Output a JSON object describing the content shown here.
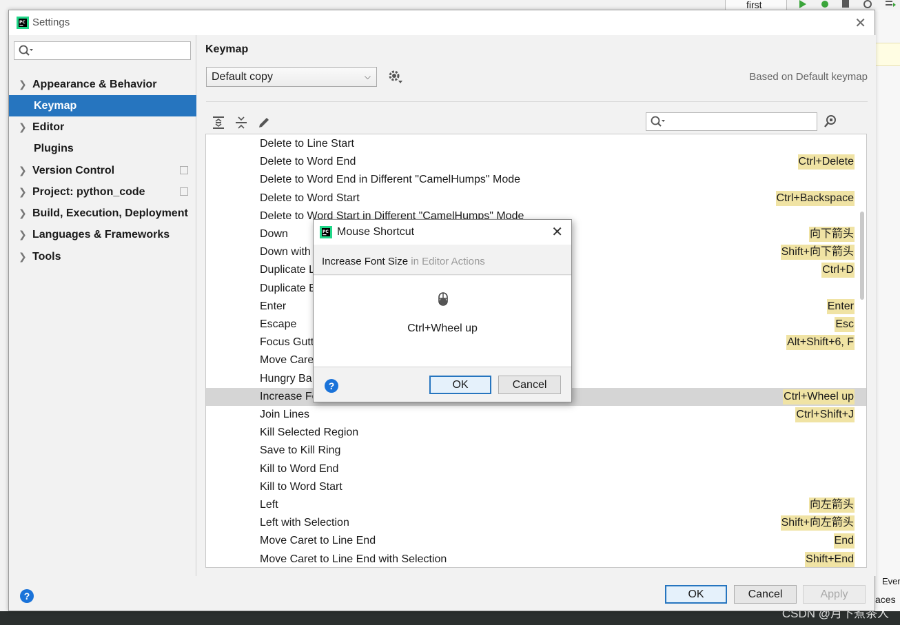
{
  "ide": {
    "run_config": "first",
    "right_text_1": "Ever",
    "right_text_2": "aces",
    "watermark": "CSDN @月下煮茶人"
  },
  "settings": {
    "title": "Settings",
    "search_placeholder": "",
    "nav": [
      {
        "label": "Appearance & Behavior",
        "expandable": true
      },
      {
        "label": "Keymap",
        "expandable": false,
        "selected": true
      },
      {
        "label": "Editor",
        "expandable": true
      },
      {
        "label": "Plugins",
        "expandable": false
      },
      {
        "label": "Version Control",
        "expandable": true,
        "project_scope": true
      },
      {
        "label": "Project: python_code",
        "expandable": true,
        "project_scope": true
      },
      {
        "label": "Build, Execution, Deployment",
        "expandable": true
      },
      {
        "label": "Languages & Frameworks",
        "expandable": true
      },
      {
        "label": "Tools",
        "expandable": true
      }
    ],
    "keymap": {
      "heading": "Keymap",
      "selected_keymap": "Default copy",
      "based_on": "Based on Default keymap",
      "actions": [
        {
          "name": "Delete to Line Start",
          "shortcut": ""
        },
        {
          "name": "Delete to Word End",
          "shortcut": "Ctrl+Delete"
        },
        {
          "name": "Delete to Word End in Different \"CamelHumps\" Mode",
          "shortcut": ""
        },
        {
          "name": "Delete to Word Start",
          "shortcut": "Ctrl+Backspace"
        },
        {
          "name": "Delete to Word Start in Different \"CamelHumps\" Mode",
          "shortcut": ""
        },
        {
          "name": "Down",
          "shortcut": "向下箭头"
        },
        {
          "name": "Down with",
          "shortcut": "Shift+向下箭头"
        },
        {
          "name": "Duplicate L",
          "shortcut": "Ctrl+D"
        },
        {
          "name": "Duplicate E",
          "shortcut": ""
        },
        {
          "name": "Enter",
          "shortcut": "Enter"
        },
        {
          "name": "Escape",
          "shortcut": "Esc"
        },
        {
          "name": "Focus Gutt",
          "shortcut": "Alt+Shift+6, F"
        },
        {
          "name": "Move Care",
          "shortcut": ""
        },
        {
          "name": "Hungry Ba",
          "shortcut": ""
        },
        {
          "name": "Increase Fo",
          "shortcut": "Ctrl+Wheel up",
          "selected": true
        },
        {
          "name": "Join Lines",
          "shortcut": "Ctrl+Shift+J"
        },
        {
          "name": "Kill Selected Region",
          "shortcut": ""
        },
        {
          "name": "Save to Kill Ring",
          "shortcut": ""
        },
        {
          "name": "Kill to Word End",
          "shortcut": ""
        },
        {
          "name": "Kill to Word Start",
          "shortcut": ""
        },
        {
          "name": "Left",
          "shortcut": "向左箭头"
        },
        {
          "name": "Left with Selection",
          "shortcut": "Shift+向左箭头"
        },
        {
          "name": "Move Caret to Line End",
          "shortcut": "End"
        },
        {
          "name": "Move Caret to Line End with Selection",
          "shortcut": "Shift+End"
        }
      ]
    },
    "buttons": {
      "ok": "OK",
      "cancel": "Cancel",
      "apply": "Apply"
    },
    "help": "?"
  },
  "mouse_dialog": {
    "title": "Mouse Shortcut",
    "action": "Increase Font Size",
    "group": " in Editor Actions",
    "value": "Ctrl+Wheel up",
    "ok": "OK",
    "cancel": "Cancel",
    "help": "?"
  },
  "colors": {
    "selection": "#2675bf",
    "shortcut_highlight": "#f0e3a4",
    "row_selected": "#d5d5d5"
  }
}
